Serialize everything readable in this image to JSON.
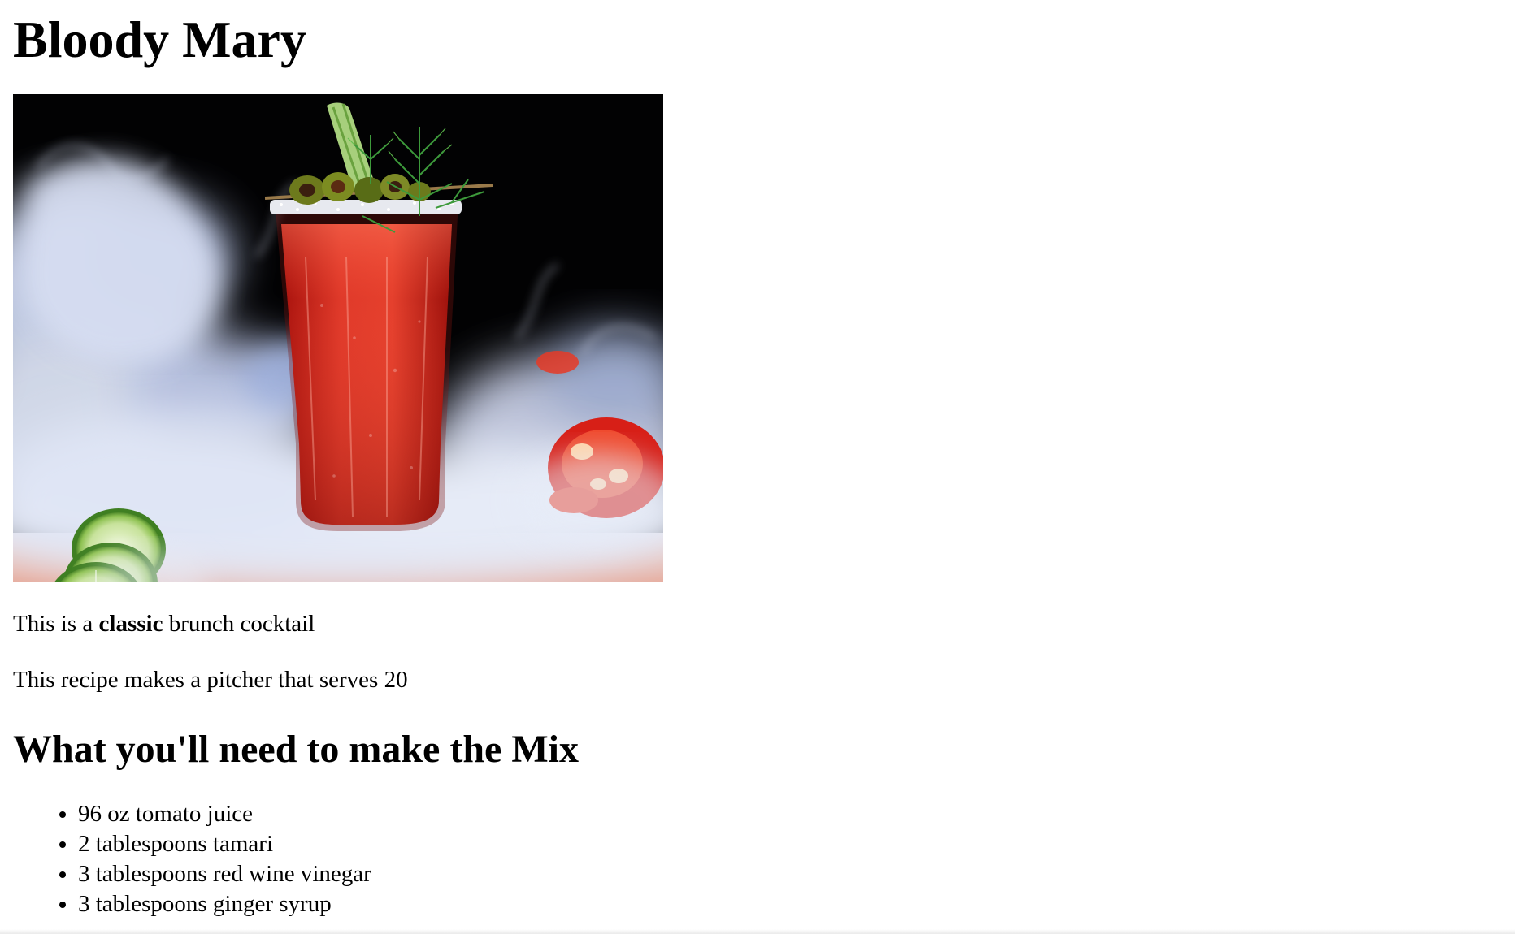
{
  "page": {
    "title": "Bloody Mary",
    "image": {
      "alt": "Bloody Mary cocktail with celery, dill, olives, lime slices and tomato in smoke",
      "icon": "cocktail-photo"
    },
    "intro": {
      "before": "This is a ",
      "emphasis": "classic",
      "after": " brunch cocktail"
    },
    "serves": "This recipe makes a pitcher that serves 20",
    "section_heading": "What you'll need to make the Mix",
    "ingredients": [
      "96 oz tomato juice",
      "2 tablespoons tamari",
      "3 tablespoons red wine vinegar",
      "3 tablespoons ginger syrup"
    ]
  },
  "colors": {
    "text": "#000000",
    "background": "#ffffff",
    "drink": "#d8261c",
    "photo_background": "#000000"
  }
}
